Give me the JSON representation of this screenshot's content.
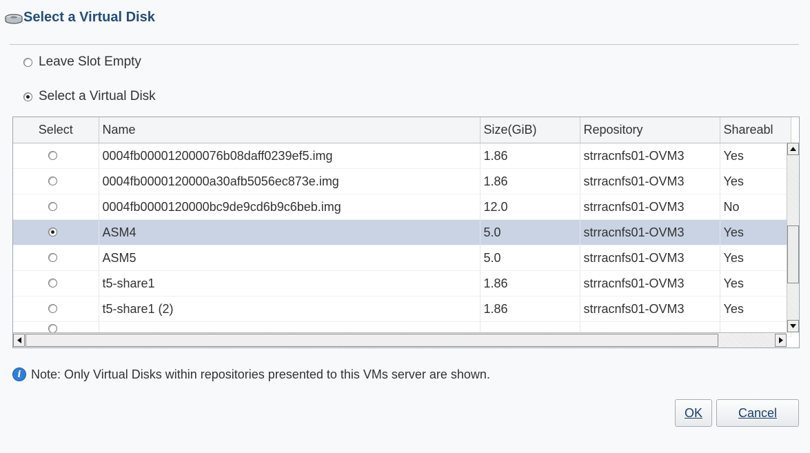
{
  "dialog": {
    "title": "Select a Virtual Disk",
    "icon": "disk-icon"
  },
  "options": {
    "leave_empty": "Leave Slot Empty",
    "select_disk": "Select a Virtual Disk",
    "selected": "select_disk"
  },
  "table": {
    "headers": [
      "Select",
      "Name",
      "Size(GiB)",
      "Repository",
      "Shareabl"
    ],
    "rows": [
      {
        "name": "0004fb000012000076b08daff0239ef5.img",
        "size": "1.86",
        "repository": "strracnfs01-OVM3",
        "shareable": "Yes",
        "selected": false
      },
      {
        "name": "0004fb0000120000a30afb5056ec873e.img",
        "size": "1.86",
        "repository": "strracnfs01-OVM3",
        "shareable": "Yes",
        "selected": false
      },
      {
        "name": "0004fb0000120000bc9de9cd6b9c6beb.img",
        "size": "12.0",
        "repository": "strracnfs01-OVM3",
        "shareable": "No",
        "selected": false
      },
      {
        "name": "ASM4",
        "size": "5.0",
        "repository": "strracnfs01-OVM3",
        "shareable": "Yes",
        "selected": true
      },
      {
        "name": "ASM5",
        "size": "5.0",
        "repository": "strracnfs01-OVM3",
        "shareable": "Yes",
        "selected": false
      },
      {
        "name": "t5-share1",
        "size": "1.86",
        "repository": "strracnfs01-OVM3",
        "shareable": "Yes",
        "selected": false
      },
      {
        "name": "t5-share1 (2)",
        "size": "1.86",
        "repository": "strracnfs01-OVM3",
        "shareable": "Yes",
        "selected": false
      }
    ]
  },
  "note": {
    "icon": "info-icon",
    "text": "Note: Only Virtual Disks within repositories presented to this VMs server are shown."
  },
  "buttons": {
    "ok": "OK",
    "cancel": "Cancel"
  },
  "colors": {
    "title": "#264d78",
    "selected_row": "#c9d3e4",
    "info": "#2f7fd6"
  }
}
